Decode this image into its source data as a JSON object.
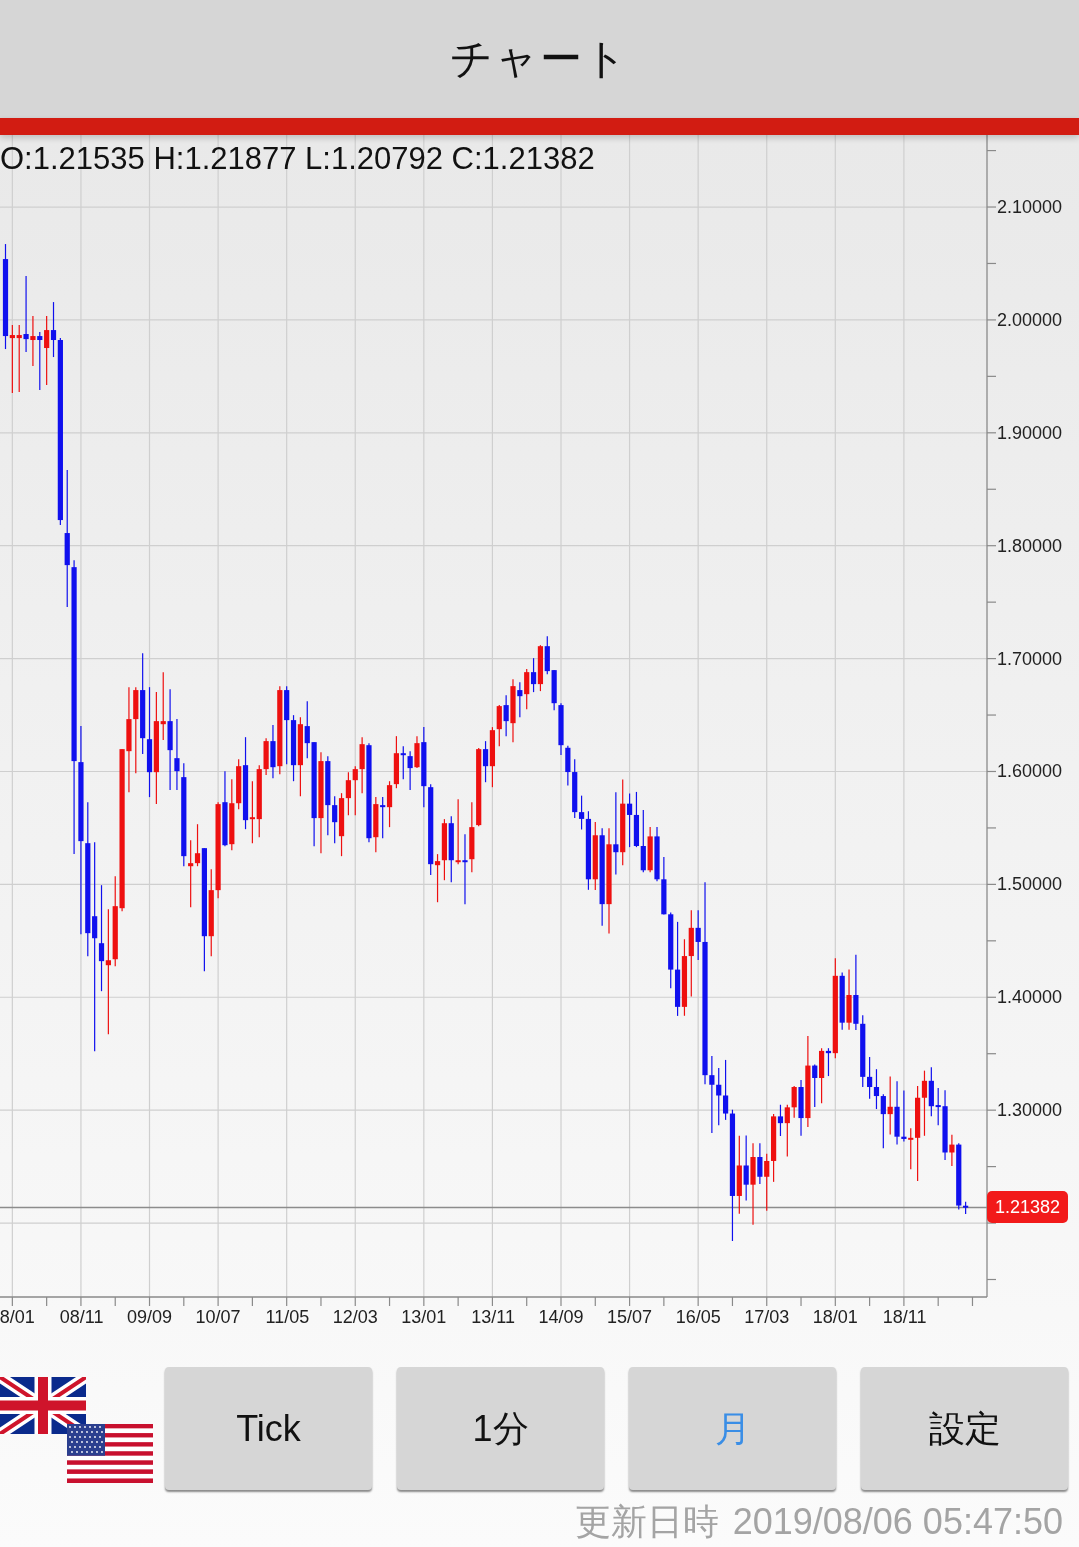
{
  "header": {
    "title": "チャート"
  },
  "chart": {
    "ohlc_readout": "O:1.21535 H:1.21877 L:1.20792 C:1.21382",
    "chart_data": {
      "type": "candlestick",
      "ylim": [
        1.1345,
        2.1638
      ],
      "grid": true,
      "categories": [
        null,
        "8/01",
        null,
        null,
        null,
        null,
        null,
        null,
        null,
        null,
        null,
        "08/11",
        null,
        null,
        null,
        null,
        null,
        null,
        null,
        null,
        null,
        "09/09",
        null,
        null,
        null,
        null,
        null,
        null,
        null,
        null,
        null,
        "10/07",
        null,
        null,
        null,
        null,
        null,
        null,
        null,
        null,
        null,
        "11/05",
        null,
        null,
        null,
        null,
        null,
        null,
        null,
        null,
        null,
        "12/03",
        null,
        null,
        null,
        null,
        null,
        null,
        null,
        null,
        null,
        "13/01",
        null,
        null,
        null,
        null,
        null,
        null,
        null,
        null,
        null,
        "13/11",
        null,
        null,
        null,
        null,
        null,
        null,
        null,
        null,
        null,
        "14/09",
        null,
        null,
        null,
        null,
        null,
        null,
        null,
        null,
        null,
        "15/07",
        null,
        null,
        null,
        null,
        null,
        null,
        null,
        null,
        null,
        "16/05",
        null,
        null,
        null,
        null,
        null,
        null,
        null,
        null,
        null,
        "17/03",
        null,
        null,
        null,
        null,
        null,
        null,
        null,
        null,
        null,
        "18/01",
        null,
        null,
        null,
        null,
        null,
        null,
        null,
        null,
        null,
        "18/11",
        null,
        null,
        null,
        null,
        null,
        null,
        null,
        null,
        null
      ],
      "ohlc": [
        [
          2.0539,
          2.0672,
          1.9742,
          1.9857
        ],
        [
          1.9839,
          1.9955,
          1.9352,
          1.9866
        ],
        [
          1.9839,
          1.9955,
          1.9361,
          1.9866
        ],
        [
          1.9875,
          2.0389,
          1.9715,
          1.983
        ],
        [
          1.9822,
          2.0034,
          1.9591,
          1.9857
        ],
        [
          1.9857,
          1.9892,
          1.9379,
          1.9822
        ],
        [
          1.9751,
          2.0034,
          1.9423,
          1.991
        ],
        [
          1.991,
          2.0158,
          1.9671,
          1.9822
        ],
        [
          1.9822,
          1.9839,
          1.8183,
          1.8227
        ],
        [
          1.8112,
          1.867,
          1.7456,
          1.7828
        ],
        [
          1.781,
          1.7872,
          1.5268,
          1.6092
        ],
        [
          1.6083,
          1.6402,
          1.4559,
          1.5383
        ],
        [
          1.5365,
          1.5728,
          1.4364,
          1.4568
        ],
        [
          1.4718,
          1.5374,
          1.3522,
          1.4523
        ],
        [
          1.4479,
          1.4993,
          1.4054,
          1.432
        ],
        [
          1.4284,
          1.478,
          1.3673,
          1.4328
        ],
        [
          1.4337,
          1.5073,
          1.4275,
          1.4807
        ],
        [
          1.4789,
          1.6198,
          1.4763,
          1.6198
        ],
        [
          1.618,
          1.6747,
          1.5817,
          1.6464
        ],
        [
          1.6464,
          1.6747,
          1.5985,
          1.6721
        ],
        [
          1.6721,
          1.7048,
          1.6154,
          1.6295
        ],
        [
          1.6286,
          1.6747,
          1.5773,
          1.5994
        ],
        [
          1.5994,
          1.6703,
          1.5711,
          1.6446
        ],
        [
          1.6419,
          1.688,
          1.6278,
          1.6446
        ],
        [
          1.6446,
          1.6729,
          1.5835,
          1.6189
        ],
        [
          1.6118,
          1.6464,
          1.5835,
          1.6003
        ],
        [
          1.595,
          1.6074,
          1.5161,
          1.525
        ],
        [
          1.5161,
          1.5392,
          1.4798,
          1.5188
        ],
        [
          1.5188,
          1.5533,
          1.5161,
          1.5276
        ],
        [
          1.5321,
          1.5321,
          1.4231,
          1.4541
        ],
        [
          1.4541,
          1.5135,
          1.4364,
          1.4949
        ],
        [
          1.4949,
          1.5728,
          1.4878,
          1.5711
        ],
        [
          1.5728,
          1.6003,
          1.5338,
          1.5347
        ],
        [
          1.5356,
          1.5932,
          1.5303,
          1.5719
        ],
        [
          1.5719,
          1.6109,
          1.5666,
          1.6047
        ],
        [
          1.6056,
          1.6304,
          1.5489,
          1.5569
        ],
        [
          1.5578,
          1.5914,
          1.5365,
          1.5595
        ],
        [
          1.5578,
          1.6056,
          1.5418,
          1.6021
        ],
        [
          1.6021,
          1.6295,
          1.5968,
          1.6269
        ],
        [
          1.6269,
          1.6411,
          1.5941,
          1.6038
        ],
        [
          1.6047,
          1.6756,
          1.5976,
          1.6721
        ],
        [
          1.6721,
          1.6756,
          1.6065,
          1.6455
        ],
        [
          1.6455,
          1.6499,
          1.5914,
          1.6056
        ],
        [
          1.6056,
          1.6481,
          1.5781,
          1.6419
        ],
        [
          1.6402,
          1.6623,
          1.6118,
          1.6251
        ],
        [
          1.626,
          1.626,
          1.5338,
          1.5587
        ],
        [
          1.5587,
          1.6171,
          1.5276,
          1.6092
        ],
        [
          1.6092,
          1.6136,
          1.5436,
          1.5702
        ],
        [
          1.5702,
          1.5781,
          1.5365,
          1.5551
        ],
        [
          1.5427,
          1.5808,
          1.525,
          1.5764
        ],
        [
          1.5764,
          1.5994,
          1.5613,
          1.5923
        ],
        [
          1.5923,
          1.6047,
          1.5613,
          1.6021
        ],
        [
          1.6021,
          1.6304,
          1.5808,
          1.6242
        ],
        [
          1.6233,
          1.6251,
          1.5374,
          1.5409
        ],
        [
          1.5418,
          1.5773,
          1.5285,
          1.5711
        ],
        [
          1.5702,
          1.5773,
          1.5409,
          1.5684
        ],
        [
          1.5684,
          1.5914,
          1.5507,
          1.5879
        ],
        [
          1.5888,
          1.6313,
          1.5852,
          1.6162
        ],
        [
          1.6162,
          1.6224,
          1.5932,
          1.6145
        ],
        [
          1.6136,
          1.618,
          1.5835,
          1.603
        ],
        [
          1.6038,
          1.6313,
          1.603,
          1.6251
        ],
        [
          1.626,
          1.6393,
          1.5684,
          1.587
        ],
        [
          1.5861,
          1.5888,
          1.5082,
          1.5179
        ],
        [
          1.517,
          1.5268,
          1.4842,
          1.5206
        ],
        [
          1.5214,
          1.5578,
          1.5037,
          1.5542
        ],
        [
          1.5542,
          1.5604,
          1.5019,
          1.5214
        ],
        [
          1.5197,
          1.5755,
          1.5179,
          1.5214
        ],
        [
          1.5214,
          1.5445,
          1.4825,
          1.5197
        ],
        [
          1.5223,
          1.5728,
          1.5108,
          1.5507
        ],
        [
          1.5525,
          1.6207,
          1.5516,
          1.6198
        ],
        [
          1.6198,
          1.6269,
          1.5905,
          1.6047
        ],
        [
          1.6047,
          1.6393,
          1.5861,
          1.6366
        ],
        [
          1.6375,
          1.6588,
          1.6224,
          1.6579
        ],
        [
          1.6588,
          1.6676,
          1.6313,
          1.6446
        ],
        [
          1.6428,
          1.6818,
          1.626,
          1.6756
        ],
        [
          1.6721,
          1.6791,
          1.6481,
          1.6667
        ],
        [
          1.6685,
          1.6907,
          1.6552,
          1.688
        ],
        [
          1.688,
          1.7004,
          1.6703,
          1.6774
        ],
        [
          1.6774,
          1.7119,
          1.6712,
          1.711
        ],
        [
          1.711,
          1.7199,
          1.6862,
          1.6889
        ],
        [
          1.6898,
          1.6898,
          1.6543,
          1.6605
        ],
        [
          1.6588,
          1.6605,
          1.6145,
          1.6233
        ],
        [
          1.621,
          1.6227,
          1.5875,
          1.5995
        ],
        [
          1.5995,
          1.6108,
          1.5589,
          1.564
        ],
        [
          1.564,
          1.5786,
          1.5486,
          1.558
        ],
        [
          1.558,
          1.5648,
          1.4952,
          1.5045
        ],
        [
          1.5045,
          1.5552,
          1.4951,
          1.5435
        ],
        [
          1.5435,
          1.5497,
          1.4634,
          1.4825
        ],
        [
          1.4825,
          1.5498,
          1.4565,
          1.5355
        ],
        [
          1.5355,
          1.5815,
          1.5088,
          1.5285
        ],
        [
          1.5285,
          1.593,
          1.517,
          1.5715
        ],
        [
          1.5715,
          1.5805,
          1.533,
          1.5615
        ],
        [
          1.5615,
          1.5819,
          1.533,
          1.534
        ],
        [
          1.534,
          1.5659,
          1.5107,
          1.5125
        ],
        [
          1.5125,
          1.5509,
          1.5107,
          1.5425
        ],
        [
          1.5425,
          1.5508,
          1.5027,
          1.5045
        ],
        [
          1.5045,
          1.5242,
          1.4733,
          1.4735
        ],
        [
          1.4735,
          1.4752,
          1.408,
          1.4245
        ],
        [
          1.4245,
          1.4668,
          1.3835,
          1.3915
        ],
        [
          1.3915,
          1.4514,
          1.3836,
          1.4365
        ],
        [
          1.4365,
          1.477,
          1.4006,
          1.4615
        ],
        [
          1.4615,
          1.477,
          1.433,
          1.449
        ],
        [
          1.449,
          1.5018,
          1.3229,
          1.331
        ],
        [
          1.331,
          1.348,
          1.2798,
          1.3225
        ],
        [
          1.3225,
          1.3373,
          1.2866,
          1.313
        ],
        [
          1.313,
          1.3445,
          1.2914,
          1.297
        ],
        [
          1.297,
          1.3004,
          1.1841,
          1.224
        ],
        [
          1.224,
          1.2774,
          1.2082,
          1.251
        ],
        [
          1.251,
          1.2775,
          1.2199,
          1.234
        ],
        [
          1.234,
          1.2706,
          1.1986,
          1.2585
        ],
        [
          1.2585,
          1.2706,
          1.2347,
          1.241
        ],
        [
          1.241,
          1.2615,
          1.2109,
          1.255
        ],
        [
          1.255,
          1.2966,
          1.2365,
          1.2945
        ],
        [
          1.2945,
          1.3048,
          1.2771,
          1.2885
        ],
        [
          1.2885,
          1.3049,
          1.259,
          1.3025
        ],
        [
          1.3025,
          1.3213,
          1.2932,
          1.3205
        ],
        [
          1.3205,
          1.3268,
          1.2774,
          1.293
        ],
        [
          1.293,
          1.3658,
          1.285,
          1.3395
        ],
        [
          1.3395,
          1.3405,
          1.3027,
          1.3285
        ],
        [
          1.3285,
          1.3549,
          1.3062,
          1.3525
        ],
        [
          1.3525,
          1.3549,
          1.3302,
          1.3505
        ],
        [
          1.3505,
          1.4345,
          1.346,
          1.419
        ],
        [
          1.419,
          1.422,
          1.3713,
          1.3775
        ],
        [
          1.3775,
          1.4245,
          1.3712,
          1.402
        ],
        [
          1.402,
          1.4377,
          1.3711,
          1.3765
        ],
        [
          1.3765,
          1.384,
          1.3205,
          1.3295
        ],
        [
          1.3295,
          1.3472,
          1.3102,
          1.3205
        ],
        [
          1.3205,
          1.3363,
          1.301,
          1.3125
        ],
        [
          1.3125,
          1.314,
          1.2662,
          1.2965
        ],
        [
          1.2965,
          1.3298,
          1.2785,
          1.303
        ],
        [
          1.303,
          1.3257,
          1.2696,
          1.2765
        ],
        [
          1.2765,
          1.3175,
          1.2723,
          1.2745
        ],
        [
          1.2745,
          1.284,
          1.2477,
          1.2755
        ],
        [
          1.2755,
          1.3215,
          1.2373,
          1.311
        ],
        [
          1.311,
          1.335,
          1.2773,
          1.326
        ],
        [
          1.326,
          1.3381,
          1.2945,
          1.3035
        ],
        [
          1.3045,
          1.3197,
          1.2866,
          1.3035
        ],
        [
          1.3035,
          1.3176,
          1.2558,
          1.2625
        ],
        [
          1.2625,
          1.2783,
          1.2506,
          1.2695
        ],
        [
          1.2695,
          1.2707,
          1.2119,
          1.2155
        ],
        [
          1.21535,
          1.21877,
          1.20792,
          1.21382
        ]
      ],
      "yticks": [
        {
          "value": 2.1,
          "label": "2.10000"
        },
        {
          "value": 2.0,
          "label": "2.00000"
        },
        {
          "value": 1.9,
          "label": "1.90000"
        },
        {
          "value": 1.8,
          "label": "1.80000"
        },
        {
          "value": 1.7,
          "label": "1.70000"
        },
        {
          "value": 1.6,
          "label": "1.60000"
        },
        {
          "value": 1.5,
          "label": "1.50000"
        },
        {
          "value": 1.4,
          "label": "1.40000"
        },
        {
          "value": 1.3,
          "label": "1.30000"
        }
      ],
      "ref_lines": [
        {
          "axis": "y",
          "value": 1.21382,
          "label": "1.21382"
        }
      ]
    }
  },
  "period_buttons": [
    {
      "label": "Tick",
      "selected": false
    },
    {
      "label": "1分",
      "selected": false
    },
    {
      "label": "月",
      "selected": true
    }
  ],
  "settings_button": {
    "label": "設定"
  },
  "footer": {
    "label": "更新日時",
    "timestamp": "2019/08/06 05:47:50"
  }
}
